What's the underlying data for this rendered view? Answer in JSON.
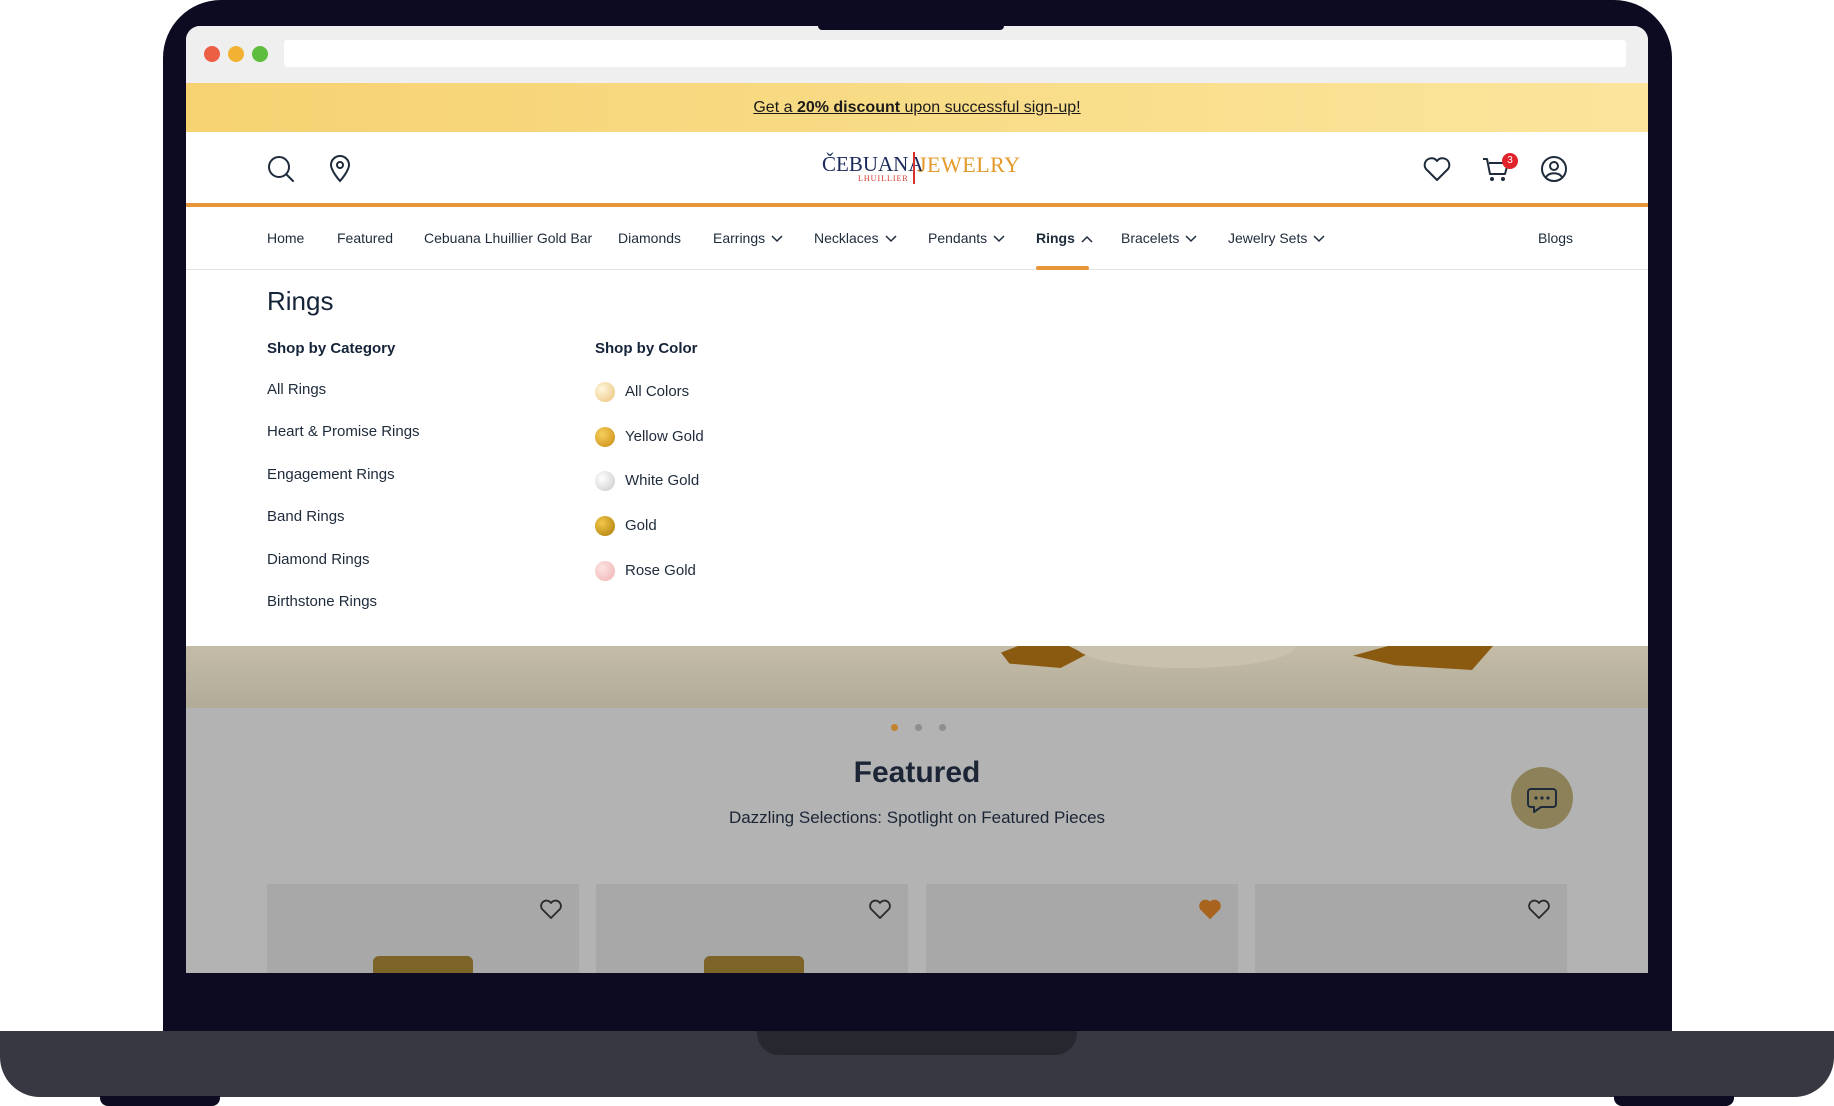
{
  "promo": {
    "prefix": "Get a ",
    "bold": "20% discount",
    "suffix": " upon successful sign-up!"
  },
  "logo": {
    "left": "ČEBUANA",
    "sub": "LHUILLIER",
    "right": "JEWELRY"
  },
  "cart": {
    "count": "3"
  },
  "nav": {
    "items": [
      {
        "label": "Home"
      },
      {
        "label": "Featured"
      },
      {
        "label": "Cebuana Lhuillier Gold Bar"
      },
      {
        "label": "Diamonds"
      },
      {
        "label": "Earrings"
      },
      {
        "label": "Necklaces"
      },
      {
        "label": "Pendants"
      },
      {
        "label": "Rings"
      },
      {
        "label": "Bracelets"
      },
      {
        "label": "Jewelry Sets"
      },
      {
        "label": "Blogs"
      }
    ],
    "active": "Rings"
  },
  "mega": {
    "title": "Rings",
    "category_heading": "Shop by Category",
    "categories": [
      "All Rings",
      "Heart & Promise Rings",
      "Engagement Rings",
      "Band Rings",
      "Diamond Rings",
      "Birthstone Rings"
    ],
    "color_heading": "Shop by Color",
    "colors": [
      {
        "label": "All Colors",
        "color": "#f3d9a0"
      },
      {
        "label": "Yellow Gold",
        "color": "#e2a623"
      },
      {
        "label": "White Gold",
        "color": "#e2e2e2"
      },
      {
        "label": "Gold",
        "color": "#c99613"
      },
      {
        "label": "Rose Gold",
        "color": "#f7c4c4"
      }
    ]
  },
  "featured": {
    "title": "Featured",
    "subtitle": "Dazzling Selections: Spotlight on Featured Pieces"
  },
  "carousel": {
    "active_index": 0,
    "count": 3
  },
  "colors": {
    "accent": "#e8963a",
    "promo": "#f6d271",
    "text": "#16243a"
  }
}
